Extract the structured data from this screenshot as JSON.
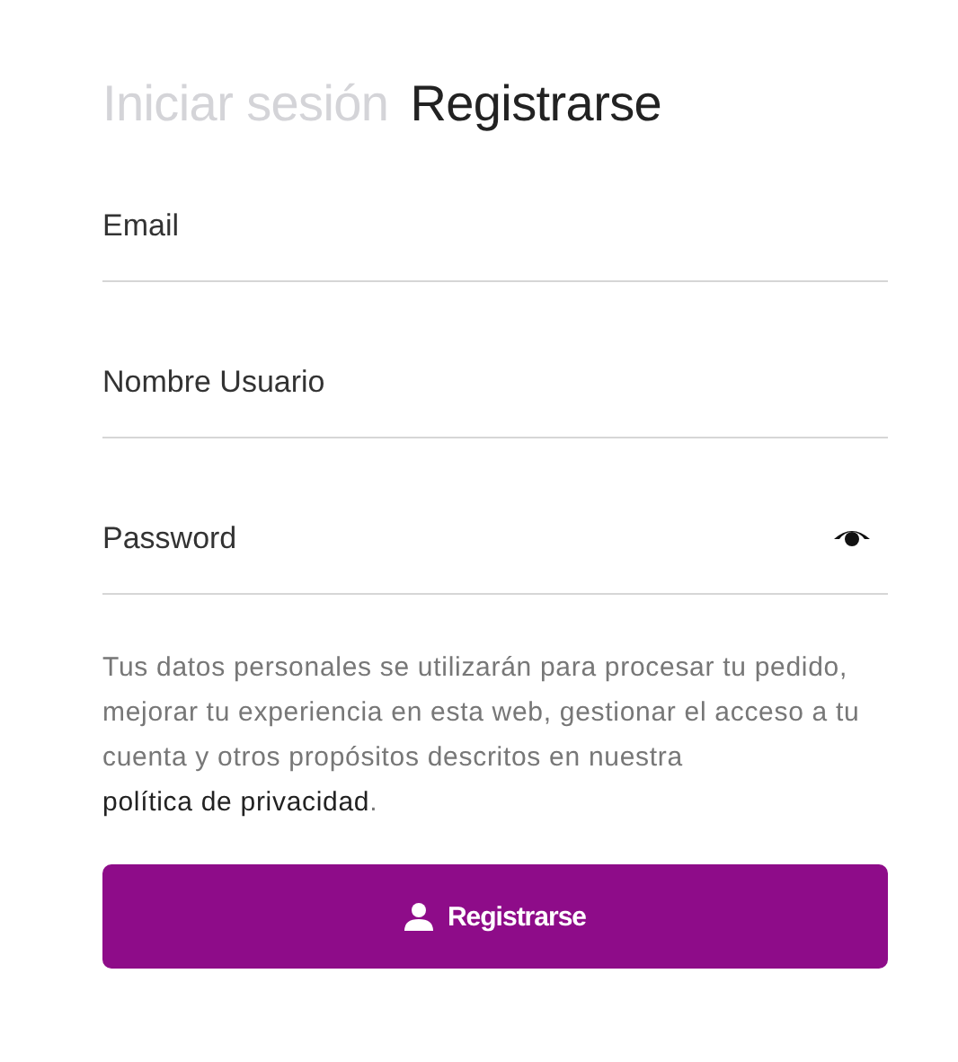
{
  "tabs": [
    {
      "label": "Iniciar sesión",
      "selected": false
    },
    {
      "label": "Registrarse",
      "selected": true
    }
  ],
  "fields": [
    {
      "placeholder": "Email",
      "kind": "text"
    },
    {
      "placeholder": "Nombre Usuario",
      "kind": "text"
    },
    {
      "placeholder": "Password",
      "kind": "password"
    }
  ],
  "notice": {
    "text": "Tus datos personales se utilizarán para procesar tu pedido, mejorar tu experiencia en esta web, gestionar el acceso a tu cuenta y otros propósitos descritos en nuestra",
    "link": "política de privacidad",
    "end": "."
  },
  "submit": {
    "label": "Registrarse"
  }
}
